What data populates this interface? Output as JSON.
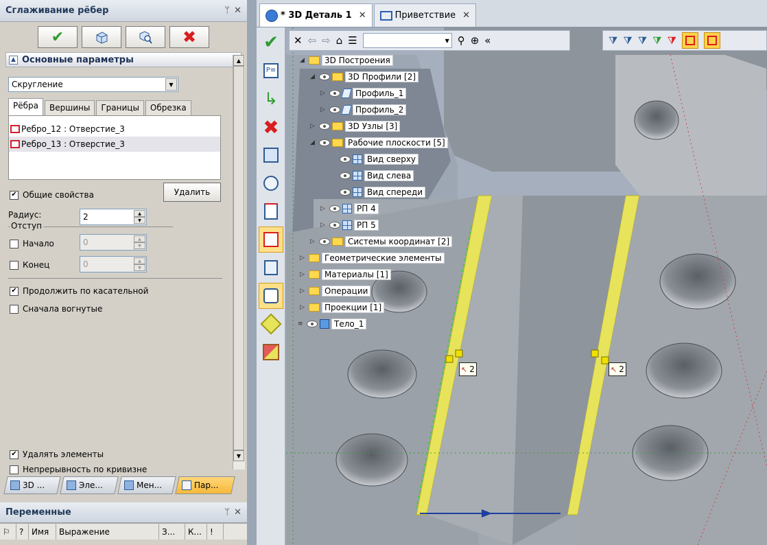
{
  "left_panel": {
    "title": "Сглаживание рёбер",
    "pin": "ᛘ",
    "close": "✕",
    "section_title": "Основные параметры",
    "type_select": "Скругление",
    "tabs": [
      "Рёбра",
      "Вершины",
      "Границы",
      "Обрезка"
    ],
    "edges": [
      "Ребро_12 : Отверстие_3",
      "Ребро_13 : Отверстие_3"
    ],
    "common_props": "Общие свойства",
    "delete_button": "Удалить",
    "radius_label": "Радиус:",
    "radius_value": "2",
    "offset_label": "Отступ",
    "start_label": "Начало",
    "start_value": "0",
    "end_label": "Конец",
    "end_value": "0",
    "tangent_label": "Продолжить по касательной",
    "concave_label": "Сначала вогнутые",
    "delete_elements_label": "Удалять элементы",
    "curvature_label": "Непрерывность по кривизне",
    "bottom_tabs": [
      "3D ...",
      "Эле...",
      "Мен...",
      "Пар..."
    ]
  },
  "vars_panel": {
    "title": "Переменные",
    "columns": [
      "?",
      "Имя",
      "Выражение",
      "З...",
      "К...",
      "!"
    ]
  },
  "doc_tabs": [
    {
      "label": "* 3D Деталь 1",
      "active": true
    },
    {
      "label": "Приветствие",
      "active": false
    }
  ],
  "tree": [
    {
      "label": "3D Построения",
      "icon": "folder",
      "expander": "◢",
      "eye": false
    },
    {
      "label": "3D Профили [2]",
      "icon": "folder",
      "expander": "◢",
      "eye": true
    },
    {
      "label": "Профиль_1",
      "icon": "profile",
      "expander": "▷",
      "eye": true
    },
    {
      "label": "Профиль_2",
      "icon": "profile",
      "expander": "▷",
      "eye": true
    },
    {
      "label": "3D Узлы [3]",
      "icon": "folder",
      "expander": "▷",
      "eye": true
    },
    {
      "label": "Рабочие плоскости [5]",
      "icon": "folder",
      "expander": "◢",
      "eye": true
    },
    {
      "label": "Вид сверху",
      "icon": "plane",
      "expander": "",
      "eye": true
    },
    {
      "label": "Вид слева",
      "icon": "plane",
      "expander": "",
      "eye": true
    },
    {
      "label": "Вид спереди",
      "icon": "plane",
      "expander": "",
      "eye": true
    },
    {
      "label": "РП 4",
      "icon": "plane",
      "expander": "▷",
      "eye": true
    },
    {
      "label": "РП 5",
      "icon": "plane",
      "expander": "▷",
      "eye": true
    },
    {
      "label": "Системы координат [2]",
      "icon": "folder",
      "expander": "▷",
      "eye": true
    },
    {
      "label": "Геометрические элементы",
      "icon": "folder",
      "expander": "▷",
      "eye": false
    },
    {
      "label": "Материалы [1]",
      "icon": "folder",
      "expander": "▷",
      "eye": false
    },
    {
      "label": "Операции",
      "icon": "folder",
      "expander": "▷",
      "eye": false
    },
    {
      "label": "Проекции [1]",
      "icon": "folder",
      "expander": "▷",
      "eye": false
    },
    {
      "label": "Тело_1",
      "icon": "body",
      "expander": "≡",
      "eye": true
    }
  ],
  "dimension_labels": [
    "2",
    "2"
  ],
  "colors": {
    "accent_check": "#2e9b2e",
    "accent_cross": "#d81e1e",
    "highlight_edge": "#e4dc3a",
    "selection_tab": "#f6b93b"
  }
}
